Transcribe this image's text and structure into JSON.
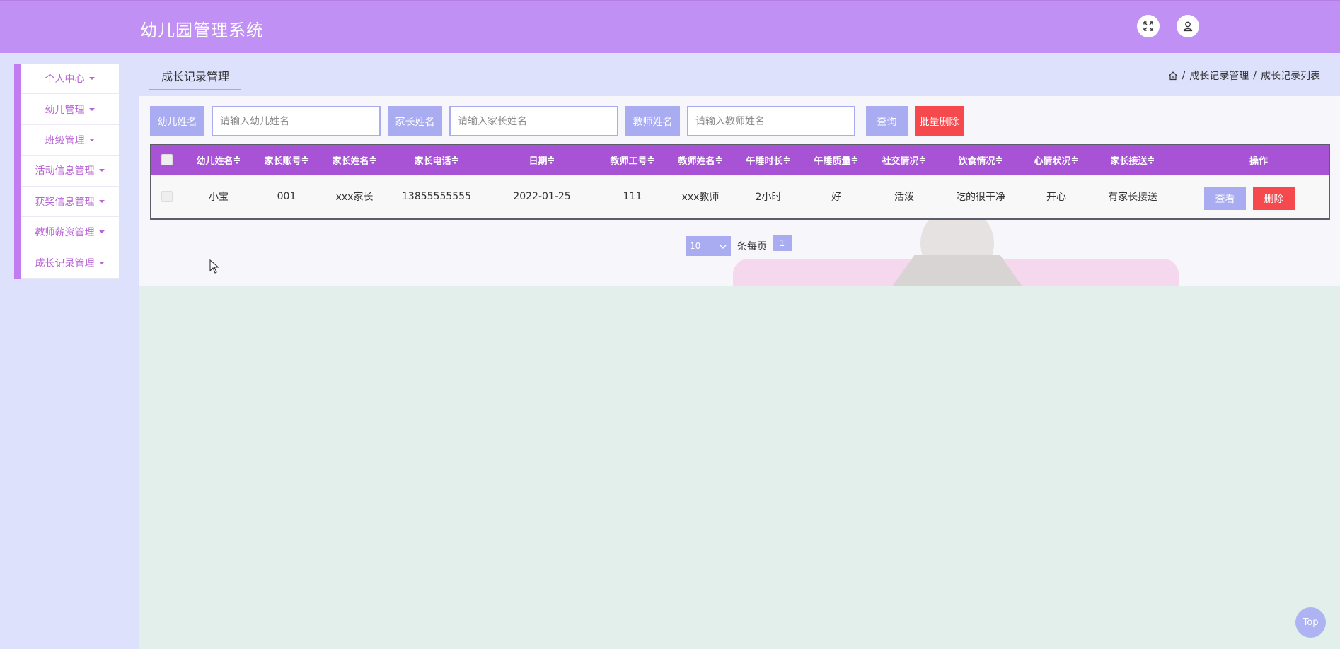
{
  "app": {
    "title": "幼儿园管理系统"
  },
  "header": {
    "fullscreen_icon": "expand-icon",
    "user_icon": "user-icon"
  },
  "sidebar": {
    "items": [
      {
        "label": "个人中心"
      },
      {
        "label": "幼儿管理"
      },
      {
        "label": "班级管理"
      },
      {
        "label": "活动信息管理"
      },
      {
        "label": "获奖信息管理"
      },
      {
        "label": "教师薪资管理"
      },
      {
        "label": "成长记录管理"
      }
    ]
  },
  "page": {
    "tab_label": "成长记录管理",
    "breadcrumb": {
      "items": [
        "成长记录管理",
        "成长记录列表"
      ],
      "separator": "/"
    }
  },
  "search": {
    "child_label": "幼儿姓名",
    "child_placeholder": "请输入幼儿姓名",
    "parent_label": "家长姓名",
    "parent_placeholder": "请输入家长姓名",
    "teacher_label": "教师姓名",
    "teacher_placeholder": "请输入教师姓名",
    "query_button": "查询",
    "batch_delete_button": "批量删除"
  },
  "table": {
    "columns": [
      "幼儿姓名",
      "家长账号",
      "家长姓名",
      "家长电话",
      "日期",
      "教师工号",
      "教师姓名",
      "午睡时长",
      "午睡质量",
      "社交情况",
      "饮食情况",
      "心情状况",
      "家长接送",
      "操作"
    ],
    "sort_indicator": "≑",
    "rows": [
      {
        "cells": [
          "小宝",
          "001",
          "xxx家长",
          "13855555555",
          "2022-01-25",
          "111",
          "xxx教师",
          "2小时",
          "好",
          "活泼",
          "吃的很干净",
          "开心",
          "有家长接送"
        ],
        "view_label": "查看",
        "delete_label": "删除"
      }
    ]
  },
  "pagination": {
    "page_size": "10",
    "per_page_text": "条每页",
    "current_page": "1"
  },
  "back_to_top": "Top",
  "colors": {
    "header": "#c090f5",
    "table_header": "#a853d6",
    "primary_button": "#a9acf1",
    "danger_button": "#f5494d"
  }
}
